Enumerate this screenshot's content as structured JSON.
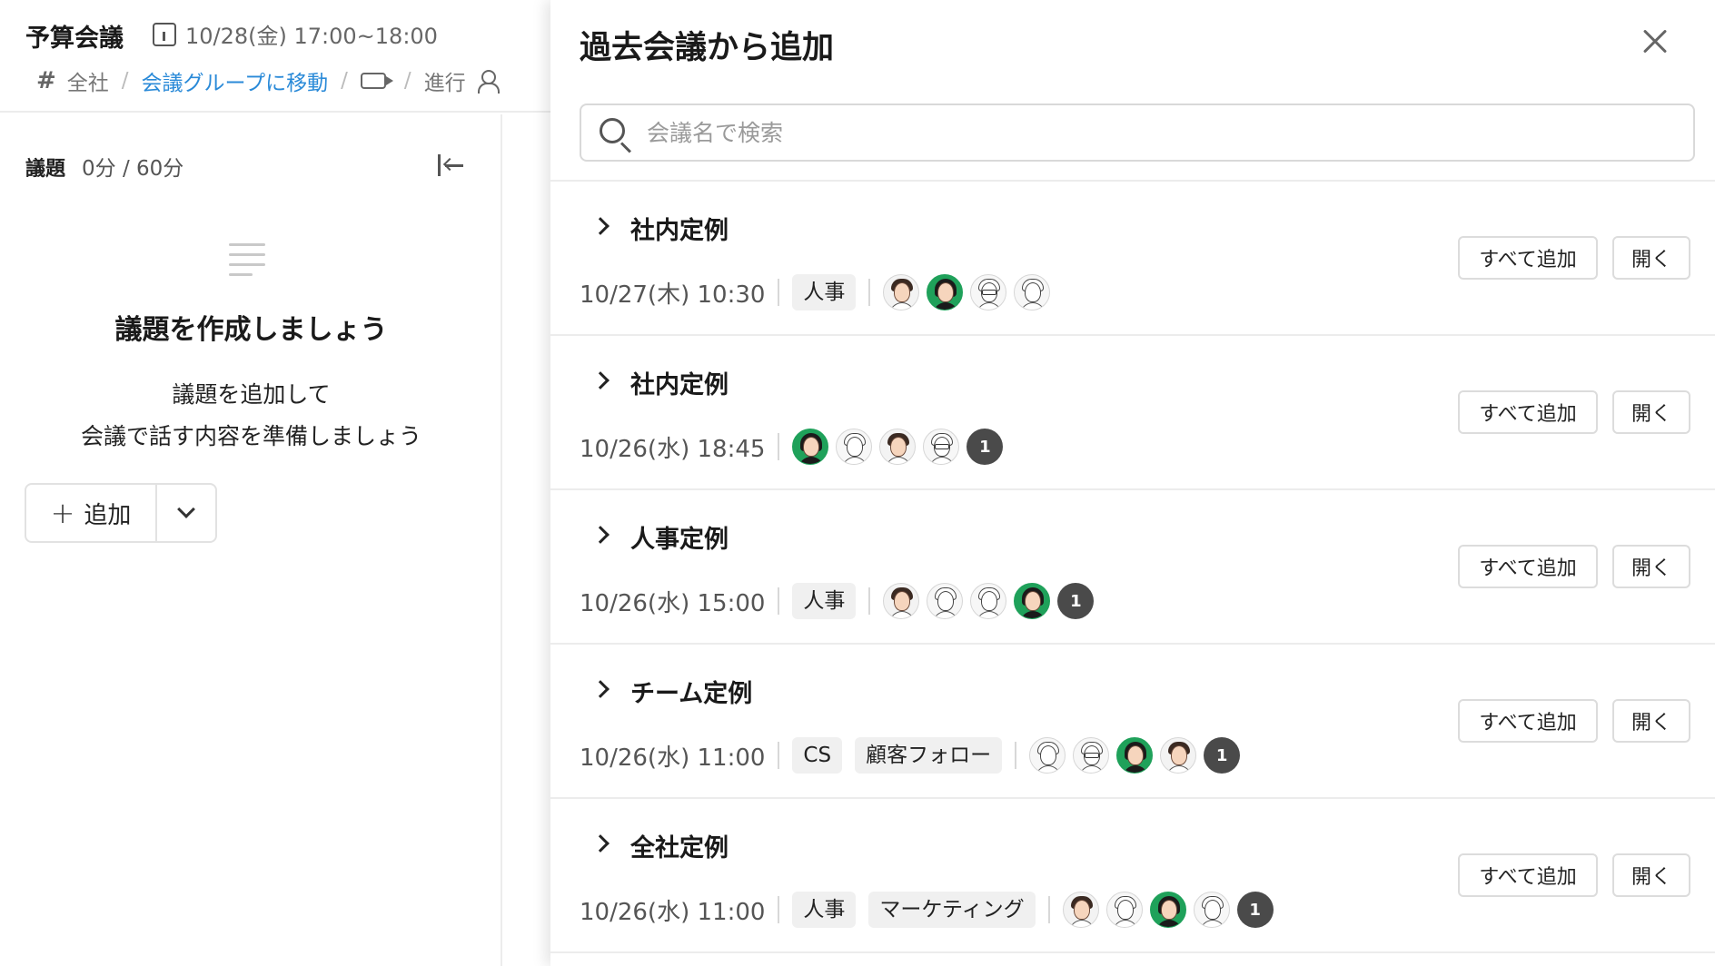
{
  "meeting": {
    "title": "予算会議",
    "datetime": "10/28(金) 17:00~18:00",
    "breadcrumb": {
      "channel": "全社",
      "group_link": "会議グループに移動",
      "progress": "進行"
    }
  },
  "agenda": {
    "label": "議題",
    "time_count": "0分 / 60分",
    "empty_title": "議題を作成しましょう",
    "empty_desc_line1": "議題を追加して",
    "empty_desc_line2": "会議で話す内容を準備しましょう",
    "add_button": "追加"
  },
  "drawer": {
    "title": "過去会議から追加",
    "search": {
      "placeholder": "会議名で検索",
      "value": ""
    },
    "add_all_label": "すべて追加",
    "open_label": "開く",
    "meetings": [
      {
        "name": "社内定例",
        "datetime": "10/27(木) 10:30",
        "tags": [
          "人事"
        ],
        "avatars": [
          "woman-brown",
          "woman-green",
          "man-glasses",
          "man-line"
        ],
        "more": ""
      },
      {
        "name": "社内定例",
        "datetime": "10/26(水) 18:45",
        "tags": [],
        "avatars": [
          "woman-green",
          "woman-line",
          "woman-brown",
          "man-glasses"
        ],
        "more": "1"
      },
      {
        "name": "人事定例",
        "datetime": "10/26(水) 15:00",
        "tags": [
          "人事"
        ],
        "avatars": [
          "woman-brown",
          "woman-line",
          "man-line",
          "woman-green"
        ],
        "more": "1"
      },
      {
        "name": "チーム定例",
        "datetime": "10/26(水) 11:00",
        "tags": [
          "CS",
          "顧客フォロー"
        ],
        "avatars": [
          "woman-line",
          "man-glasses",
          "woman-green",
          "woman-brown"
        ],
        "more": "1"
      },
      {
        "name": "全社定例",
        "datetime": "10/26(水) 11:00",
        "tags": [
          "人事",
          "マーケティング"
        ],
        "avatars": [
          "woman-brown",
          "woman-line",
          "woman-green",
          "man-line"
        ],
        "more": "1"
      }
    ]
  },
  "icons": {
    "calendar": "calendar-icon",
    "channel": "hash-icon",
    "video": "video-icon",
    "person": "person-icon",
    "collapse": "collapse-left-icon",
    "list": "list-icon",
    "plus": "plus-icon",
    "dropdown": "chevron-down-icon",
    "close": "close-icon",
    "search": "search-icon",
    "expand": "chevron-right-icon"
  },
  "colors": {
    "link": "#2a8ad8",
    "tag_bg": "#f0f0f0",
    "avatar_green": "#1fa15a",
    "badge_bg": "#4a4a4a"
  }
}
